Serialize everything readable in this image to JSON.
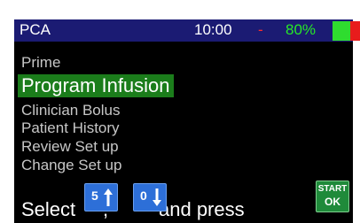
{
  "status_bar": {
    "app_name": "PCA",
    "time": "10:00",
    "separator": "-",
    "battery_percent": "80%",
    "battery_level_fraction": 0.8,
    "colors": {
      "bar": "#1b1b73",
      "percent": "#27e827",
      "separator": "#ff2b2b"
    }
  },
  "menu": {
    "items": [
      {
        "label": "Prime",
        "selected": false
      },
      {
        "label": "Program Infusion",
        "selected": true
      },
      {
        "label": "Clinician Bolus",
        "selected": false
      },
      {
        "label": "Patient History",
        "selected": false
      },
      {
        "label": "Review Set up",
        "selected": false
      },
      {
        "label": "Change Set up",
        "selected": false
      }
    ],
    "highlight_color": "#1b7d1b"
  },
  "instruction": {
    "select": "Select",
    "comma": ",",
    "and_press": "and press"
  },
  "keys": {
    "up": {
      "number": "5",
      "icon": "arrow-up-icon"
    },
    "down": {
      "number": "0",
      "icon": "arrow-down-icon"
    },
    "start_ok": {
      "line1": "START",
      "line2": "OK"
    }
  }
}
